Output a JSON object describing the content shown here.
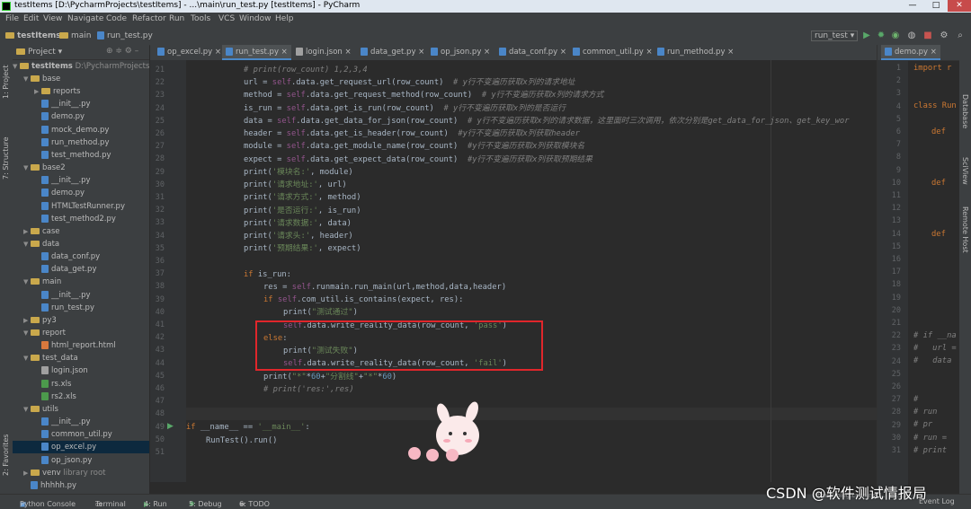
{
  "window": {
    "title": "testItems [D:\\PycharmProjects\\testItems] - ...\\main\\run_test.py [testItems] - PyCharm",
    "controls": [
      "—",
      "□",
      "✕"
    ]
  },
  "menu": [
    "File",
    "Edit",
    "View",
    "Navigate",
    "Code",
    "Refactor",
    "Run",
    "Tools",
    "VCS",
    "Window",
    "Help"
  ],
  "breadcrumb": [
    "testItems",
    "main",
    "run_test.py"
  ],
  "run_config": "run_test",
  "project_panel": {
    "header": "Project",
    "root": "testItems",
    "root_path": "D:\\PycharmProjects\\",
    "tree": [
      {
        "label": "base",
        "type": "folder",
        "depth": 1,
        "open": true
      },
      {
        "label": "reports",
        "type": "folder",
        "depth": 2,
        "open": false
      },
      {
        "label": "__init__.py",
        "type": "file",
        "depth": 2
      },
      {
        "label": "demo.py",
        "type": "file",
        "depth": 2
      },
      {
        "label": "mock_demo.py",
        "type": "file",
        "depth": 2
      },
      {
        "label": "run_method.py",
        "type": "file",
        "depth": 2
      },
      {
        "label": "test_method.py",
        "type": "file",
        "depth": 2
      },
      {
        "label": "base2",
        "type": "folder",
        "depth": 1,
        "open": true
      },
      {
        "label": "__init__.py",
        "type": "file",
        "depth": 2
      },
      {
        "label": "demo.py",
        "type": "file",
        "depth": 2
      },
      {
        "label": "HTMLTestRunner.py",
        "type": "file",
        "depth": 2
      },
      {
        "label": "test_method2.py",
        "type": "file",
        "depth": 2
      },
      {
        "label": "case",
        "type": "folder",
        "depth": 1,
        "open": false
      },
      {
        "label": "data",
        "type": "folder",
        "depth": 1,
        "open": true
      },
      {
        "label": "data_conf.py",
        "type": "file",
        "depth": 2
      },
      {
        "label": "data_get.py",
        "type": "file",
        "depth": 2
      },
      {
        "label": "main",
        "type": "folder",
        "depth": 1,
        "open": true
      },
      {
        "label": "__init__.py",
        "type": "file",
        "depth": 2
      },
      {
        "label": "run_test.py",
        "type": "file",
        "depth": 2
      },
      {
        "label": "py3",
        "type": "folder",
        "depth": 1,
        "open": false
      },
      {
        "label": "report",
        "type": "folder",
        "depth": 1,
        "open": true
      },
      {
        "label": "html_report.html",
        "type": "file",
        "depth": 2
      },
      {
        "label": "test_data",
        "type": "folder",
        "depth": 1,
        "open": true
      },
      {
        "label": "login.json",
        "type": "file",
        "depth": 2
      },
      {
        "label": "rs.xls",
        "type": "file",
        "depth": 2
      },
      {
        "label": "rs2.xls",
        "type": "file",
        "depth": 2
      },
      {
        "label": "utils",
        "type": "folder",
        "depth": 1,
        "open": true
      },
      {
        "label": "__init__.py",
        "type": "file",
        "depth": 2
      },
      {
        "label": "common_util.py",
        "type": "file",
        "depth": 2
      },
      {
        "label": "op_excel.py",
        "type": "file",
        "depth": 2,
        "selected": true
      },
      {
        "label": "op_json.py",
        "type": "file",
        "depth": 2
      },
      {
        "label": "venv",
        "type": "folder",
        "depth": 1,
        "open": false,
        "suffix": "library root"
      },
      {
        "label": "hhhhh.py",
        "type": "file",
        "depth": 1
      }
    ]
  },
  "editor_tabs": [
    "op_excel.py",
    "run_test.py",
    "login.json",
    "data_get.py",
    "op_json.py",
    "data_conf.py",
    "common_util.py",
    "run_method.py"
  ],
  "active_tab": "run_test.py",
  "line_numbers": [
    "21",
    "22",
    "23",
    "24",
    "25",
    "26",
    "27",
    "28",
    "29",
    "30",
    "31",
    "32",
    "33",
    "34",
    "35",
    "36",
    "37",
    "38",
    "39",
    "40",
    "41",
    "42",
    "43",
    "44",
    "45",
    "46",
    "47",
    "48",
    "49",
    "50",
    "51"
  ],
  "code": {
    "l21": "# print(row_count) 1,2,3,4",
    "l22a": "url = ",
    "l22b": "self",
    "l22c": ".data.get_request_url(row_count)  ",
    "l22d": "# y行不变遍历获取x列的请求地址",
    "l23a": "method = ",
    "l23b": "self",
    "l23c": ".data.get_request_method(row_count)  ",
    "l23d": "# y行不变遍历获取x列的请求方式",
    "l24a": "is_run = ",
    "l24b": "self",
    "l24c": ".data.get_is_run(row_count)  ",
    "l24d": "# y行不变遍历获取x列的是否运行",
    "l25a": "data = ",
    "l25b": "self",
    "l25c": ".data.get_data_for_json(row_count)  ",
    "l25d": "# y行不变遍历获取x列的请求数据，这里面时三次调用，依次分别是get_data_for_json、get_key_wor",
    "l26a": "header = ",
    "l26b": "self",
    "l26c": ".data.get_is_header(row_count)  ",
    "l26d": "#y行不变遍历获取x列获取header",
    "l27a": "module = ",
    "l27b": "self",
    "l27c": ".data.get_module_name(row_count)  ",
    "l27d": "#y行不变遍历获取x列获取模块名",
    "l28a": "expect = ",
    "l28b": "self",
    "l28c": ".data.get_expect_data(row_count)  ",
    "l28d": "#y行不变遍历获取x列获取预期结果",
    "l29a": "print(",
    "l29b": "'模块名:'",
    "l29c": ", module)",
    "l30a": "print(",
    "l30b": "'请求地址:'",
    "l30c": ", url)",
    "l31a": "print(",
    "l31b": "'请求方式:'",
    "l31c": ", method)",
    "l32a": "print(",
    "l32b": "'是否运行:'",
    "l32c": ", is_run)",
    "l33a": "print(",
    "l33b": "'请求数据:'",
    "l33c": ", data)",
    "l34a": "print(",
    "l34b": "'请求头:'",
    "l34c": ", header)",
    "l35a": "print(",
    "l35b": "'预期结果:'",
    "l35c": ", expect)",
    "l37a": "if ",
    "l37b": "is_run:",
    "l38a": "res = ",
    "l38b": "self",
    "l38c": ".runmain.run_main(url,method,data,header)",
    "l39a": "if ",
    "l39b": "self",
    "l39c": ".com_util.is_contains(expect, res):",
    "l40a": "print(",
    "l40b": "\"测试通过\"",
    "l40c": ")",
    "l41a": "self",
    "l41b": ".data.write_reality_data(row_count, ",
    "l41c": "'pass'",
    "l41d": ")",
    "l42a": "else",
    "l42b": ":",
    "l43a": "print(",
    "l43b": "\"测试失败\"",
    "l43c": ")",
    "l44a": "self",
    "l44b": ".data.write_reality_data(row_count, ",
    "l44c": "'fail'",
    "l44d": ")",
    "l45a": "print(",
    "l45b": "\"*\"",
    "l45c": "*",
    "l45d": "60",
    "l45e": "+",
    "l45f": "\"分割线\"",
    "l45g": "+",
    "l45h": "\"*\"",
    "l45i": "*",
    "l45j": "60",
    "l45k": ")",
    "l46": "# print('res:',res)",
    "l49a": "if ",
    "l49b": "__name__ == ",
    "l49c": "'__main__'",
    "l49d": ":",
    "l50": "RunTest().run()"
  },
  "right_pane": {
    "tab": "demo.py",
    "lines": [
      "import r",
      "class Run",
      "def",
      "def",
      "def",
      "# if __na",
      "#   url =",
      "#   data",
      "#",
      "# run",
      "# pr",
      "# run =",
      "# print"
    ],
    "numbers": [
      "1",
      "2",
      "3",
      "4",
      "5",
      "6",
      "7",
      "8",
      "9",
      "10",
      "11",
      "12",
      "13",
      "14",
      "15",
      "16",
      "17",
      "18",
      "19",
      "20",
      "21",
      "22",
      "23",
      "24",
      "25",
      "26",
      "27",
      "28",
      "29",
      "30",
      "31"
    ]
  },
  "side_tools": {
    "left": [
      "1: Project",
      "7: Structure",
      "2: Favorites"
    ],
    "right": [
      "Database",
      "SciView",
      "Remote Host"
    ]
  },
  "bottom_tools": [
    "Python Console",
    "Terminal",
    "4: Run",
    "5: Debug",
    "6: TODO"
  ],
  "event_log": "Event Log",
  "watermark": "CSDN @软件测试情报局",
  "watermark_url": "https://blog.csdn.net/... 25:25",
  "colors": {
    "highlight_box": "#e0262b",
    "keyword": "#cc7832",
    "string": "#6a8759",
    "comment": "#808080",
    "self": "#94558d"
  }
}
